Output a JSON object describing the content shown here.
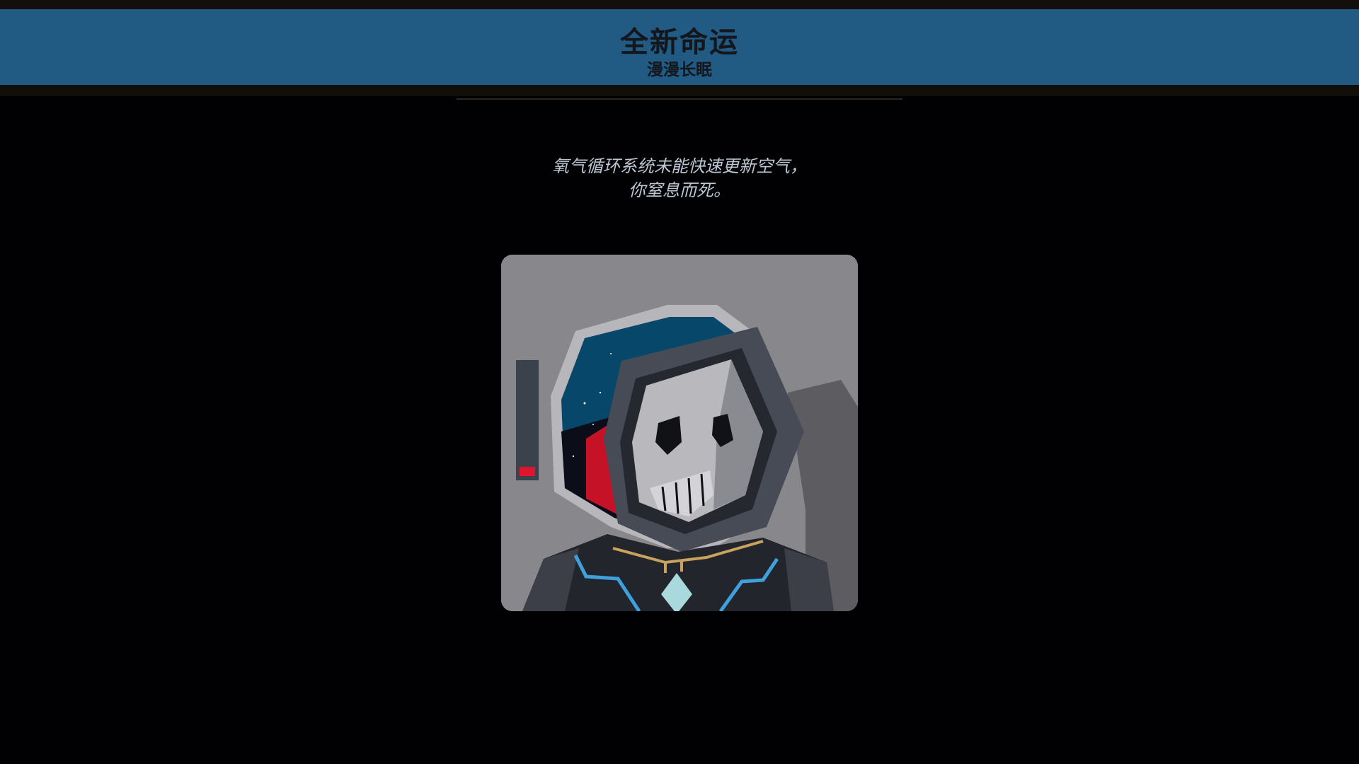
{
  "banner": {
    "title": "全新命运",
    "subtitle": "漫漫长眠"
  },
  "death_message": {
    "line1": "氧气循环系统未能快速更新空气，",
    "line2": "你窒息而死。"
  },
  "portrait": {
    "subject": "skull-astronaut",
    "oxygen_level": 0.08,
    "colors": {
      "background": "#88878b",
      "space": "#07476a",
      "nebula": "#c51226",
      "oxygen_bar": "#e0142e",
      "suit": "#23252c",
      "trim": "#3fa0dc",
      "collar": "#c9a25b"
    }
  }
}
